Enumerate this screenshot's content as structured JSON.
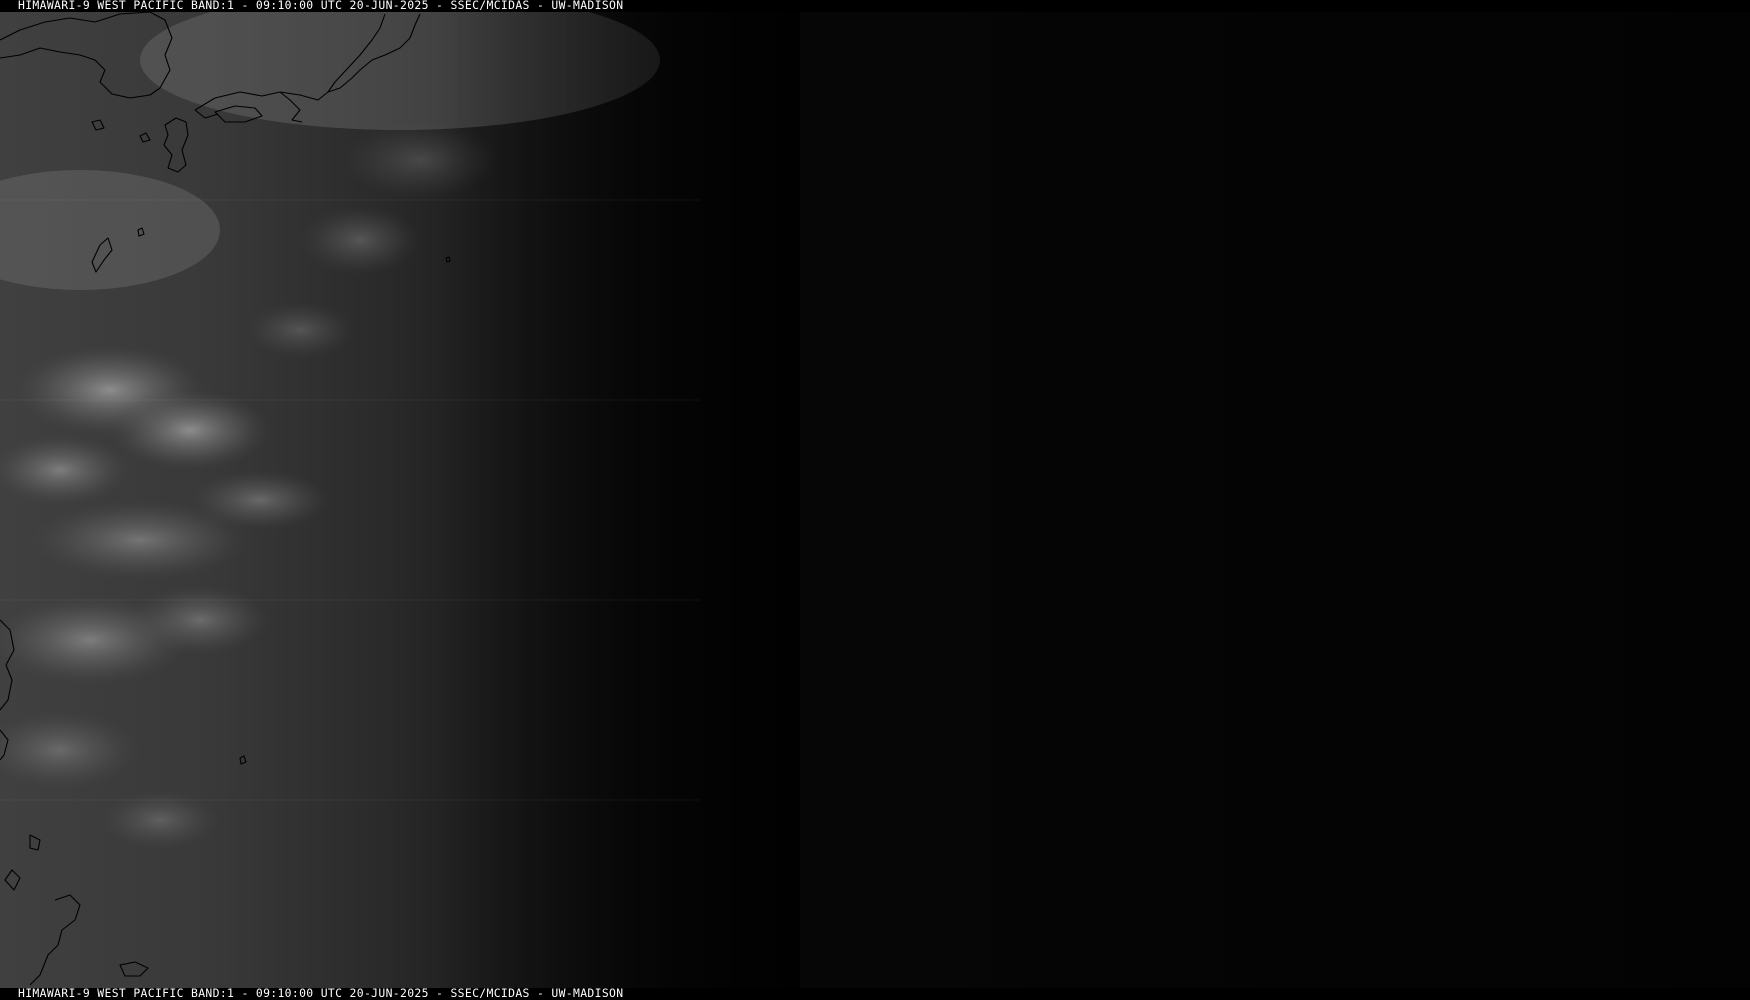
{
  "caption": {
    "top": "HIMAWARI-9 WEST PACIFIC BAND:1 - 09:10:00 UTC 20-JUN-2025 - SSEC/MCIDAS - UW-MADISON",
    "bottom": "HIMAWARI-9 WEST PACIFIC BAND:1 - 09:10:00 UTC 20-JUN-2025 - SSEC/MCIDAS - UW-MADISON"
  },
  "image": {
    "kind": "visible-band grayscale satellite imagery",
    "terminator": "day side on left, night side on right",
    "colors": {
      "background": "#000000",
      "caption_text": "#ffffff",
      "coastline": "#000000",
      "bright_cloud": "#c8c8c8",
      "ocean_day": "#333333"
    }
  }
}
